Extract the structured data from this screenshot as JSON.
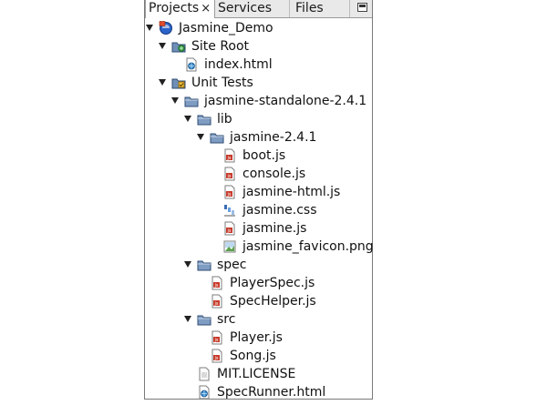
{
  "tabs": [
    {
      "label": "Projects",
      "close": "×"
    },
    {
      "label": "Services"
    },
    {
      "label": "Files"
    }
  ],
  "tree": [
    {
      "label": "Jasmine_Demo",
      "icon": "project-icon",
      "depth": 0,
      "toggle": true
    },
    {
      "label": "Site Root",
      "icon": "site-root-icon",
      "depth": 1,
      "toggle": true
    },
    {
      "label": "index.html",
      "icon": "html-file-icon",
      "depth": 2,
      "toggle": false
    },
    {
      "label": "Unit Tests",
      "icon": "unit-tests-icon",
      "depth": 1,
      "toggle": true
    },
    {
      "label": "jasmine-standalone-2.4.1",
      "icon": "folder-icon",
      "depth": 2,
      "toggle": true
    },
    {
      "label": "lib",
      "icon": "folder-icon",
      "depth": 3,
      "toggle": true
    },
    {
      "label": "jasmine-2.4.1",
      "icon": "folder-icon",
      "depth": 4,
      "toggle": true
    },
    {
      "label": "boot.js",
      "icon": "js-file-icon",
      "depth": 5,
      "toggle": false
    },
    {
      "label": "console.js",
      "icon": "js-file-icon",
      "depth": 5,
      "toggle": false
    },
    {
      "label": "jasmine-html.js",
      "icon": "js-file-icon",
      "depth": 5,
      "toggle": false
    },
    {
      "label": "jasmine.css",
      "icon": "css-file-icon",
      "depth": 5,
      "toggle": false
    },
    {
      "label": "jasmine.js",
      "icon": "js-file-icon",
      "depth": 5,
      "toggle": false
    },
    {
      "label": "jasmine_favicon.png",
      "icon": "image-file-icon",
      "depth": 5,
      "toggle": false
    },
    {
      "label": "spec",
      "icon": "folder-icon",
      "depth": 3,
      "toggle": true
    },
    {
      "label": "PlayerSpec.js",
      "icon": "js-file-icon",
      "depth": 4,
      "toggle": false
    },
    {
      "label": "SpecHelper.js",
      "icon": "js-file-icon",
      "depth": 4,
      "toggle": false
    },
    {
      "label": "src",
      "icon": "folder-icon",
      "depth": 3,
      "toggle": true
    },
    {
      "label": "Player.js",
      "icon": "js-file-icon",
      "depth": 4,
      "toggle": false
    },
    {
      "label": "Song.js",
      "icon": "js-file-icon",
      "depth": 4,
      "toggle": false
    },
    {
      "label": "MIT.LICENSE",
      "icon": "text-file-icon",
      "depth": 3,
      "toggle": false
    },
    {
      "label": "SpecRunner.html",
      "icon": "html-file-icon",
      "depth": 3,
      "toggle": false
    }
  ],
  "colors": {
    "folder": "#4a6a92",
    "js_badge": "#c83a2a",
    "selection": "#ffffff"
  }
}
